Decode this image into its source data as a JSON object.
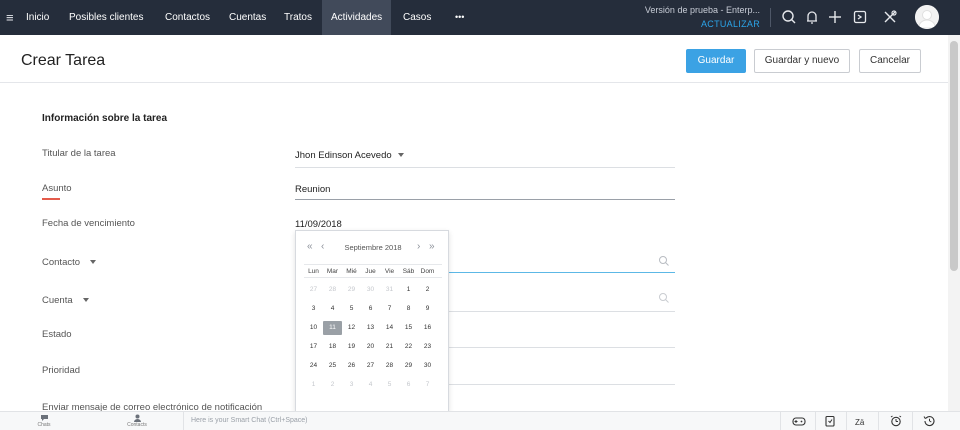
{
  "nav": {
    "items": [
      "Inicio",
      "Posibles clientes",
      "Contactos",
      "Cuentas",
      "Tratos",
      "Actividades",
      "Casos",
      "•••"
    ],
    "active_index": 5,
    "trial_text": "Versión de prueba - Enterp...",
    "upgrade_label": "ACTUALIZAR"
  },
  "header": {
    "title": "Crear Tarea",
    "save_label": "Guardar",
    "save_new_label": "Guardar y nuevo",
    "cancel_label": "Cancelar"
  },
  "form": {
    "section_title": "Información sobre la tarea",
    "fields": {
      "owner": {
        "label": "Titular de la tarea",
        "value": "Jhon Edinson Acevedo"
      },
      "subject": {
        "label": "Asunto",
        "value": "Reunion"
      },
      "due_date": {
        "label": "Fecha de vencimiento",
        "value": "11/09/2018"
      },
      "contact": {
        "label": "Contacto"
      },
      "account": {
        "label": "Cuenta"
      },
      "status": {
        "label": "Estado"
      },
      "priority": {
        "label": "Prioridad"
      },
      "notify": {
        "label": "Enviar mensaje de correo electrónico de notificación"
      }
    }
  },
  "datepicker": {
    "month_label": "Septiembre 2018",
    "weekdays": [
      "Lun",
      "Mar",
      "Mié",
      "Jue",
      "Vie",
      "Sáb",
      "Dom"
    ],
    "weeks": [
      [
        "27",
        "28",
        "29",
        "30",
        "31",
        "1",
        "2"
      ],
      [
        "3",
        "4",
        "5",
        "6",
        "7",
        "8",
        "9"
      ],
      [
        "10",
        "11",
        "12",
        "13",
        "14",
        "15",
        "16"
      ],
      [
        "17",
        "18",
        "19",
        "20",
        "21",
        "22",
        "23"
      ],
      [
        "24",
        "25",
        "26",
        "27",
        "28",
        "29",
        "30"
      ],
      [
        "1",
        "2",
        "3",
        "4",
        "5",
        "6",
        "7"
      ]
    ],
    "muted": [
      [
        0,
        0
      ],
      [
        0,
        1
      ],
      [
        0,
        2
      ],
      [
        0,
        3
      ],
      [
        0,
        4
      ],
      [
        5,
        0
      ],
      [
        5,
        1
      ],
      [
        5,
        2
      ],
      [
        5,
        3
      ],
      [
        5,
        4
      ],
      [
        5,
        5
      ],
      [
        5,
        6
      ]
    ],
    "selected": [
      2,
      1
    ]
  },
  "bottombar": {
    "chats_label": "Chats",
    "contacts_label": "Contacts",
    "smartchat_placeholder": "Here is your Smart Chat (Ctrl+Space)"
  }
}
